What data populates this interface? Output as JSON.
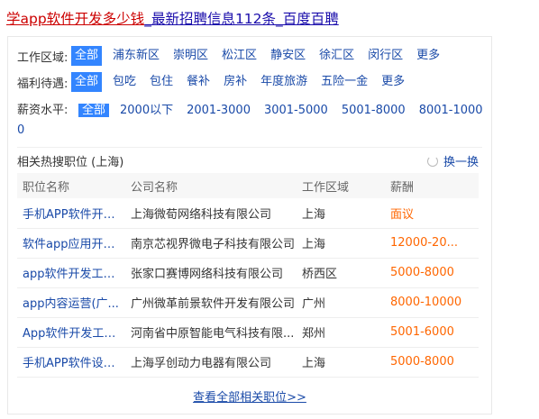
{
  "title": {
    "highlight": "学app软件开发多少钱",
    "rest": "_最新招聘信息112条_百度百聘"
  },
  "filters": {
    "area": {
      "label": "工作区域:",
      "options": [
        "全部",
        "浦东新区",
        "崇明区",
        "松江区",
        "静安区",
        "徐汇区",
        "闵行区",
        "更多"
      ]
    },
    "welfare": {
      "label": "福利待遇:",
      "options": [
        "全部",
        "包吃",
        "包住",
        "餐补",
        "房补",
        "年度旅游",
        "五险一金",
        "更多"
      ]
    },
    "salary": {
      "label": "薪资水平:",
      "options": [
        "全部",
        "2000以下",
        "2001-3000",
        "3001-5000",
        "5001-8000",
        "8001-10000"
      ]
    }
  },
  "related": {
    "title": "相关热搜职位 (上海)",
    "refresh_label": "换一换",
    "columns": [
      "职位名称",
      "公司名称",
      "工作区域",
      "薪酬"
    ],
    "rows": [
      {
        "job": "手机APP软件开发...",
        "company": "上海微荀网络科技有限公司",
        "area": "上海",
        "salary": "面议"
      },
      {
        "job": "软件app应用开发...",
        "company": "南京芯视界微电子科技有限公司",
        "area": "上海",
        "salary": "12000-20..."
      },
      {
        "job": "app软件开发工程师",
        "company": "张家口赛博网络科技有限公司",
        "area": "桥西区",
        "salary": "5000-8000"
      },
      {
        "job": "app内容运营(广...",
        "company": "广州微革前景软件开发有限公司",
        "area": "广州",
        "salary": "8000-10000"
      },
      {
        "job": "App软件开发工程...",
        "company": "河南省中原智能电气科技有限...",
        "area": "郑州",
        "salary": "5001-6000"
      },
      {
        "job": "手机APP软件设计...",
        "company": "上海孚创动力电器有限公司",
        "area": "上海",
        "salary": "5000-8000"
      }
    ]
  },
  "view_all": "查看全部相关职位>>",
  "colors": {
    "accent": "#3385ff",
    "link": "#1a4aa8",
    "salary": "#ff6600",
    "title_highlight": "#cc0000"
  }
}
